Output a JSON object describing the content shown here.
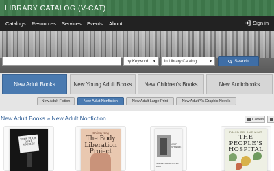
{
  "header": {
    "title": "LIBRARY CATALOG (V-CAT)"
  },
  "nav": {
    "items": [
      "Catalogs",
      "Resources",
      "Services",
      "Events",
      "About"
    ],
    "sign_in": "Sign in"
  },
  "search": {
    "input_value": "",
    "scope_select": "by Keyword",
    "location_select": "in Library Catalog",
    "button_label": "Search"
  },
  "category_tabs": [
    {
      "label": "New Adult Books",
      "active": true
    },
    {
      "label": "New Young Adult Books",
      "active": false
    },
    {
      "label": "New Children's Books",
      "active": false
    },
    {
      "label": "New Audiobooks",
      "active": false
    }
  ],
  "sub_tabs": [
    {
      "label": "New Adult Fiction",
      "active": false
    },
    {
      "label": "New Adult Nonfiction",
      "active": true
    },
    {
      "label": "New Adult Large Print",
      "active": false
    },
    {
      "label": "New Adult/YA Graphic Novels",
      "active": false
    }
  ],
  "breadcrumb": {
    "text": "New Adult Books » New Adult Nonfiction"
  },
  "view": {
    "covers_label": "Covers"
  },
  "books": [
    {
      "cover_text": "VERY FUCK REAL STORIES",
      "icon": "book-cover"
    },
    {
      "author": "Chrissy King",
      "title": "The Body Liberation Project",
      "icon": "book-cover"
    },
    {
      "author": "JEFF SHARLET",
      "bottom_text": "SCENES FROM A CIVIL WAR",
      "icon": "book-cover"
    },
    {
      "author": "DAVID SPLANE KING",
      "title": "THE PEOPLE'S HOSPITAL",
      "icon": "book-cover"
    }
  ],
  "colors": {
    "header_green": "#3f7a4c",
    "nav_dark": "#222222",
    "accent_blue": "#4a7ab0",
    "link_blue": "#2f5e96"
  }
}
